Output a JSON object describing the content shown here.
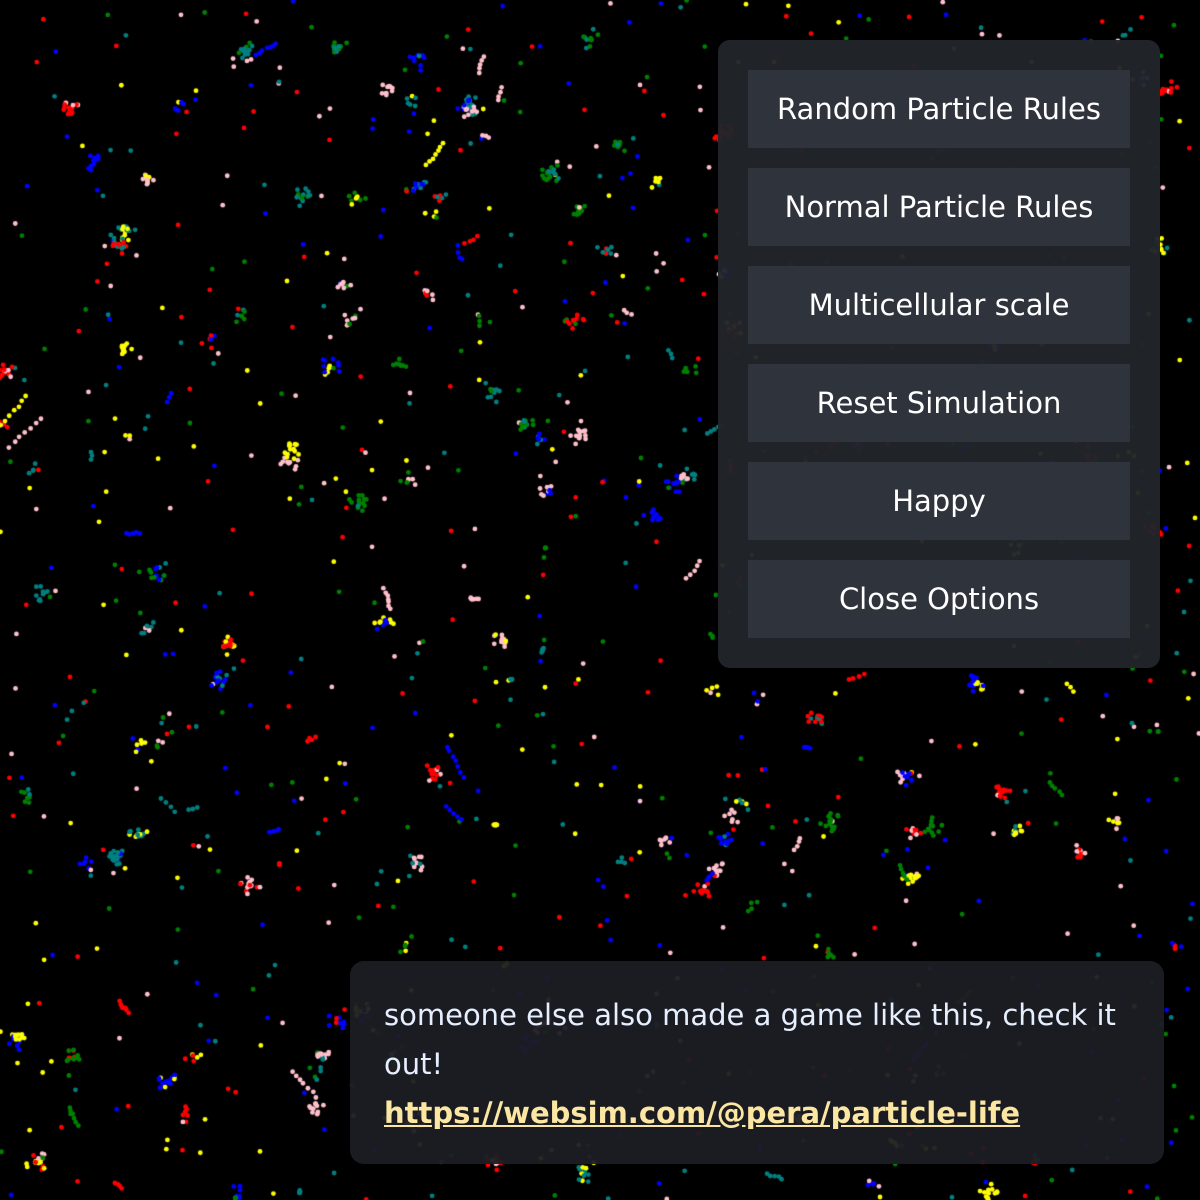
{
  "simulation": {
    "background": "#000000",
    "particle_colors": [
      "#ff0000",
      "#0000ff",
      "#ffff00",
      "#008000",
      "#008080",
      "#ffc0cb"
    ]
  },
  "options": {
    "buttons": [
      {
        "label": "Random Particle Rules"
      },
      {
        "label": "Normal Particle Rules"
      },
      {
        "label": "Multicellular scale"
      },
      {
        "label": "Reset Simulation"
      },
      {
        "label": "Happy"
      },
      {
        "label": "Close Options"
      }
    ]
  },
  "message": {
    "text": "someone else also made a game like this, check it out!",
    "link_text": "https://websim.com/@pera/particle-life",
    "link_color": "#fbe6a2"
  }
}
